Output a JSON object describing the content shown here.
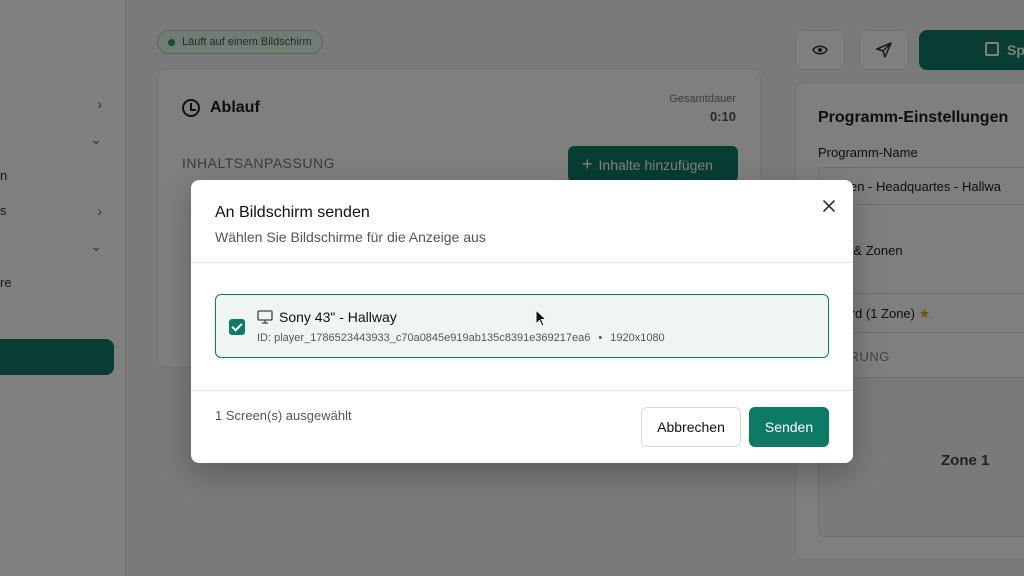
{
  "background": {
    "status_pill": "Läuft auf einem Bildschirm",
    "save_label": "Sp",
    "sidebar_fragments": [
      "n",
      "s",
      "re"
    ],
    "timeline": {
      "title": "Ablauf",
      "total_label": "Gesamtdauer",
      "total_value": "0:10",
      "section_label": "INHALTSANPASSUNG",
      "add_button": "Inhalte hinzufügen"
    },
    "settings": {
      "title": "Programm-Einstellungen",
      "name_label": "Programm-Name",
      "name_value": "nchen - Headquartes - Hallwa",
      "layout_label": "ayout & Zonen",
      "layout_caption": "UT",
      "layout_value": "ndard (1 Zone)",
      "orientation_caption": "NTIERUNG",
      "zone_label": "Zone 1"
    }
  },
  "modal": {
    "title": "An Bildschirm senden",
    "subtitle": "Wählen Sie Bildschirme für die Anzeige aus",
    "screens": [
      {
        "name": "Sony 43\" - Hallway",
        "id_text": "ID: player_1786523443933_c70a0845e919ab135c8391e369217ea6",
        "separator": "•",
        "resolution": "1920x1080",
        "selected": true
      }
    ],
    "selected_count": "1 Screen(s) ausgewählt",
    "cancel_label": "Abbrechen",
    "send_label": "Senden"
  },
  "colors": {
    "accent": "#0e7a66",
    "status_green": "#22a652"
  }
}
